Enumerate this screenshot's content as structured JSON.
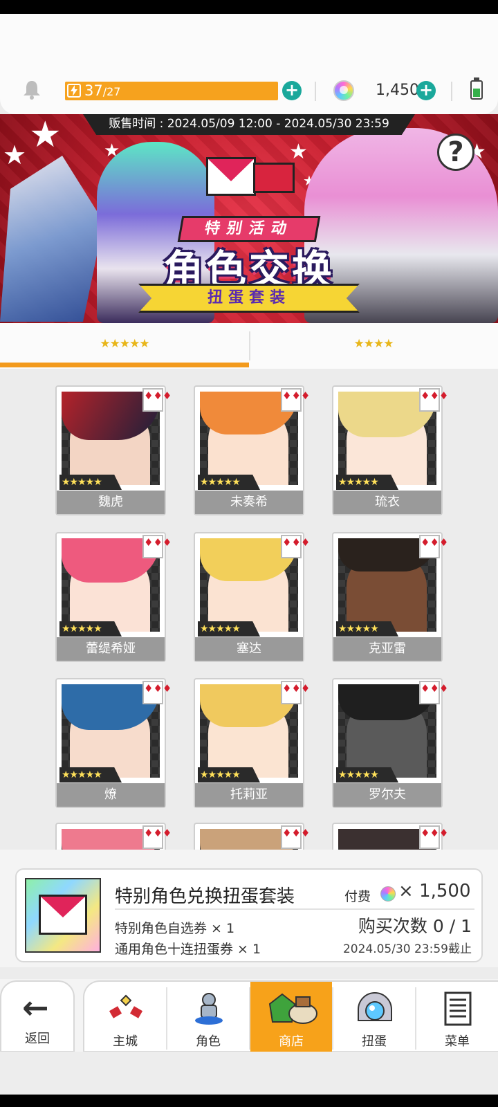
{
  "resources": {
    "energy_current": "37",
    "energy_max": "/27",
    "gems": "1,450",
    "accent_energy": "#f6a21e",
    "accent_plus": "#1aa89b"
  },
  "banner": {
    "sale_period": "贩售时间 : 2024.05/09 12:00 - 2024.05/30 23:59",
    "tag": "特别活动",
    "title": "角色交换",
    "subtitle": "扭蛋套装",
    "help": "?"
  },
  "tabs": [
    {
      "label": "★★★★★",
      "active": true
    },
    {
      "label": "★★★★",
      "active": false
    }
  ],
  "characters": [
    {
      "name": "魏虎",
      "rarity": "★★★★★"
    },
    {
      "name": "未奏希",
      "rarity": "★★★★★"
    },
    {
      "name": "琉衣",
      "rarity": "★★★★★"
    },
    {
      "name": "蕾缇希娅",
      "rarity": "★★★★★"
    },
    {
      "name": "塞达",
      "rarity": "★★★★★"
    },
    {
      "name": "克亚雷",
      "rarity": "★★★★★"
    },
    {
      "name": "燎",
      "rarity": "★★★★★"
    },
    {
      "name": "托莉亚",
      "rarity": "★★★★★"
    },
    {
      "name": "罗尔夫",
      "rarity": "★★★★★"
    }
  ],
  "suit_symbol": "♦♦♦",
  "purchase": {
    "title": "特别角色兑换扭蛋套装",
    "price_label": "付费",
    "price": "× 1,500",
    "item1": "特别角色自选券 × 1",
    "item2": "通用角色十连扭蛋券 × 1",
    "buy_count": "购买次数 0 / 1",
    "deadline": "2024.05/30 23:59截止"
  },
  "nav": {
    "back": "返回",
    "items": [
      "主城",
      "角色",
      "商店",
      "扭蛋",
      "菜单"
    ],
    "active": "商店",
    "accent": "#f7a21a"
  }
}
